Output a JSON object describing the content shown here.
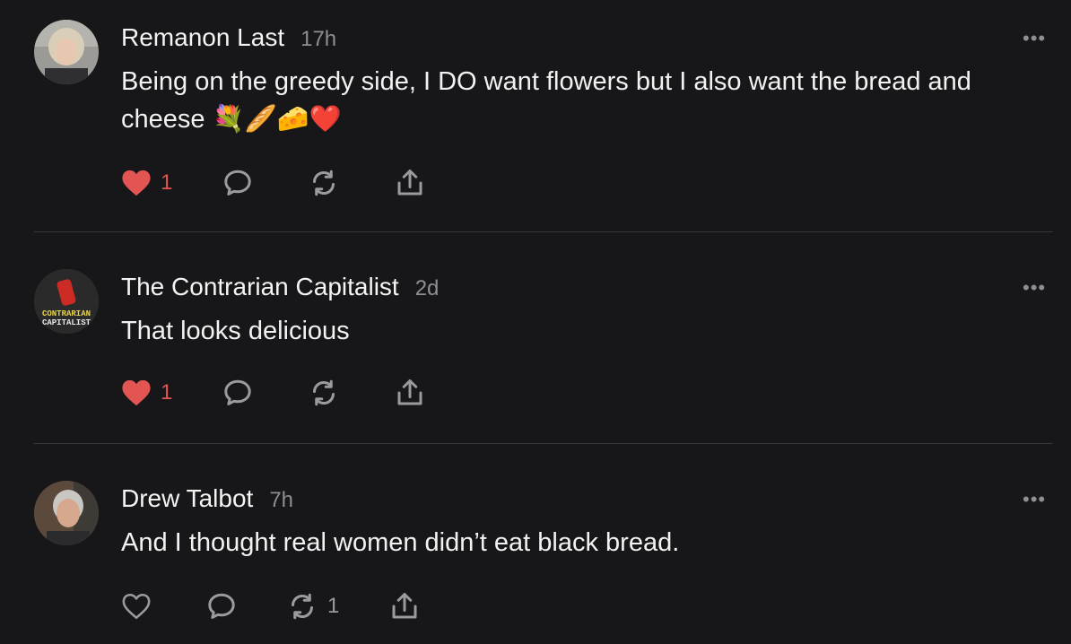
{
  "comments": [
    {
      "author": "Remanon Last",
      "time": "17h",
      "text": "Being on the greedy side, I DO want flowers but I also want the bread and cheese 💐🥖🧀❤️",
      "more": "•••",
      "like_count": "1",
      "liked": true,
      "restack_count": ""
    },
    {
      "author": "The Contrarian Capitalist",
      "time": "2d",
      "text": "That looks delicious",
      "more": "•••",
      "like_count": "1",
      "liked": true,
      "restack_count": "",
      "avatar_text": [
        "CONTRARIAN",
        "CAPITALIST"
      ]
    },
    {
      "author": "Drew Talbot",
      "time": "7h",
      "text": "And I thought real women didn’t eat black bread.",
      "more": "•••",
      "like_count": "",
      "liked": false,
      "restack_count": "1"
    }
  ],
  "colors": {
    "liked_red": "#e35553",
    "icon_gray": "#9a9a9f",
    "background": "#171719"
  }
}
